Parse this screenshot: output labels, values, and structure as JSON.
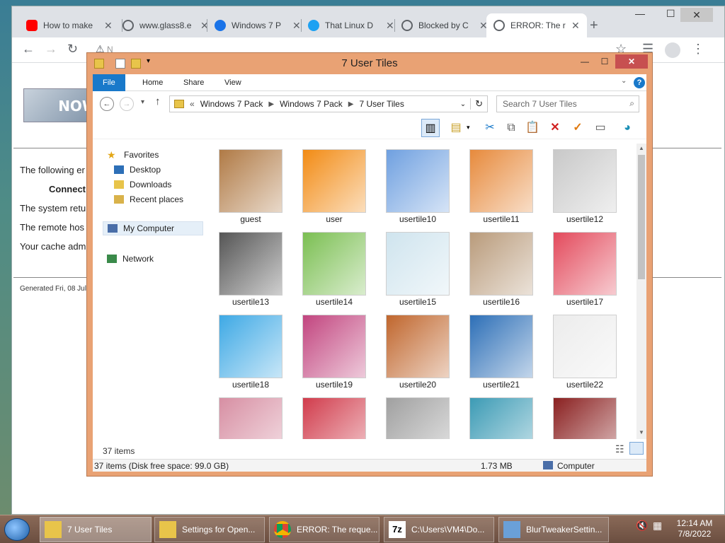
{
  "browser": {
    "tabs": [
      {
        "title": "How to make",
        "icon": "youtube-icon",
        "icon_color": "#ff0000"
      },
      {
        "title": "www.glass8.e",
        "icon": "globe-icon",
        "icon_color": "#5f6368"
      },
      {
        "title": "Windows 7 P",
        "icon": "site-icon",
        "icon_color": "#1a73e8"
      },
      {
        "title": "That Linux D",
        "icon": "twitter-icon",
        "icon_color": "#1da1f2"
      },
      {
        "title": "Blocked by C",
        "icon": "globe-icon",
        "icon_color": "#5f6368"
      },
      {
        "title": "ERROR: The r",
        "icon": "globe-icon",
        "icon_color": "#5f6368"
      }
    ],
    "address_placeholder": "N"
  },
  "error_page": {
    "logo_text": "NOW",
    "lines": [
      "The following er",
      "Connect",
      "The system retu",
      "The remote hos",
      "Your cache adm"
    ],
    "generated": "Generated Fri, 08 Jul"
  },
  "explorer": {
    "title": "7 User Tiles",
    "ribbon_tabs": [
      "File",
      "Home",
      "Share",
      "View"
    ],
    "address": {
      "prefix": "«",
      "crumbs": [
        "Windows 7 Pack",
        "Windows 7 Pack",
        "7 User Tiles"
      ]
    },
    "search_placeholder": "Search 7 User Tiles",
    "nav": {
      "favorites": "Favorites",
      "desktop": "Desktop",
      "downloads": "Downloads",
      "recent": "Recent places",
      "my_computer": "My Computer",
      "network": "Network"
    },
    "tiles": [
      {
        "label": "guest",
        "color": "#b07a45"
      },
      {
        "label": "user",
        "color": "#f28b14"
      },
      {
        "label": "usertile10",
        "color": "#6fa0e0"
      },
      {
        "label": "usertile11",
        "color": "#e78a3c"
      },
      {
        "label": "usertile12",
        "color": "#c8c8c8"
      },
      {
        "label": "usertile13",
        "color": "#555555"
      },
      {
        "label": "usertile14",
        "color": "#7bbf52"
      },
      {
        "label": "usertile15",
        "color": "#cfe4ee"
      },
      {
        "label": "usertile16",
        "color": "#b99b7b"
      },
      {
        "label": "usertile17",
        "color": "#e34a5c"
      },
      {
        "label": "usertile18",
        "color": "#3ea9e5"
      },
      {
        "label": "usertile19",
        "color": "#c2457f"
      },
      {
        "label": "usertile20",
        "color": "#c0662d"
      },
      {
        "label": "usertile21",
        "color": "#2d6fb7"
      },
      {
        "label": "usertile22",
        "color": "#ececec"
      },
      {
        "label": "",
        "color": "#d78fa3"
      },
      {
        "label": "",
        "color": "#d13c4c"
      },
      {
        "label": "",
        "color": "#a0a0a0"
      },
      {
        "label": "",
        "color": "#3c9bb5"
      },
      {
        "label": "",
        "color": "#8a2020"
      }
    ],
    "items_count": "37 items",
    "status": {
      "left": "37 items (Disk free space: 99.0 GB)",
      "size": "1.73 MB",
      "location": "Computer"
    }
  },
  "taskbar": {
    "items": [
      {
        "label": "7 User Tiles",
        "icon": "folder-icon",
        "icon_color": "#e8c44a"
      },
      {
        "label": "Settings for Open...",
        "icon": "settings-window-icon",
        "icon_color": "#e8c44a"
      },
      {
        "label": "ERROR: The reque...",
        "icon": "chrome-icon",
        "icon_color": "#4285f4"
      },
      {
        "label": "C:\\Users\\VM4\\Do...",
        "icon": "7zip-icon",
        "icon_color": "#000000"
      },
      {
        "label": "BlurTweakerSettin...",
        "icon": "blurtweaker-icon",
        "icon_color": "#6aa0d8"
      }
    ],
    "clock_time": "12:14 AM",
    "clock_date": "7/8/2022"
  }
}
